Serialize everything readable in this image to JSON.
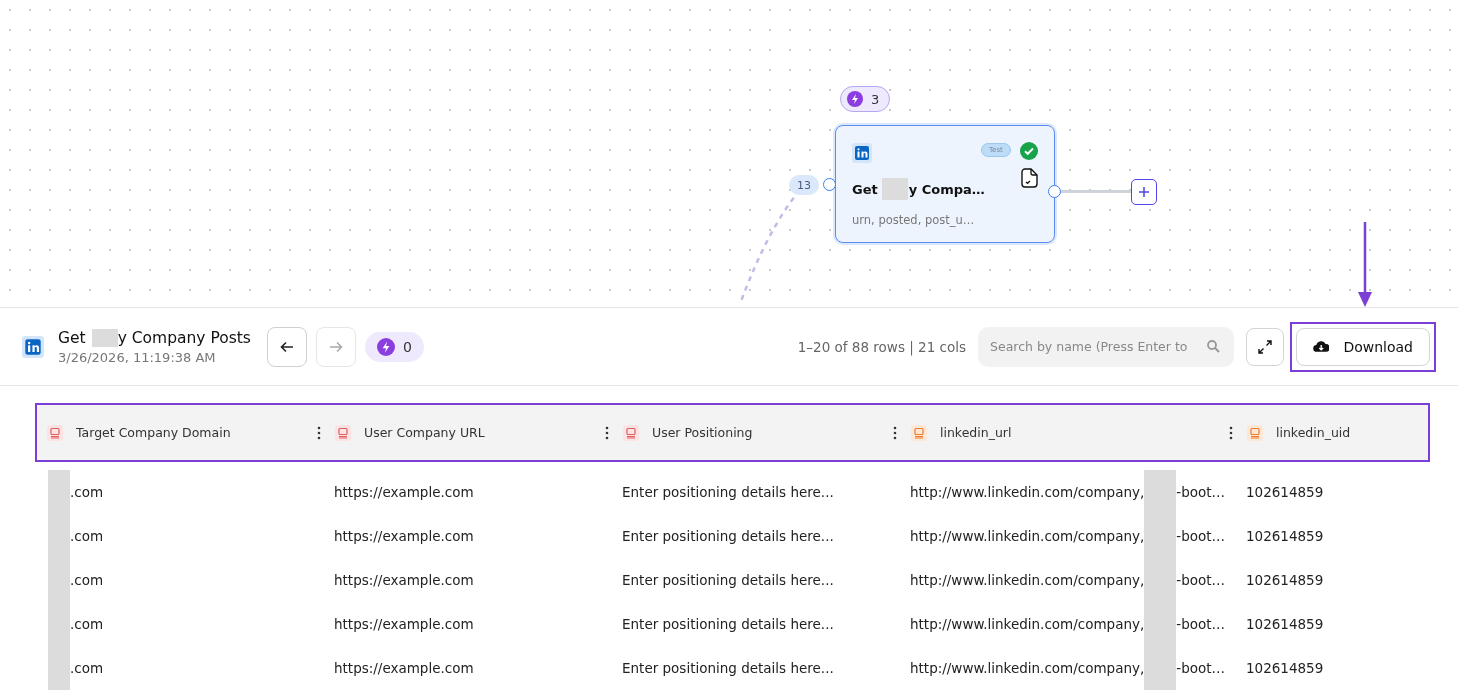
{
  "canvas": {
    "node": {
      "run_count": "3",
      "input_count": "13",
      "tag": "Test",
      "verified": true,
      "title_parts": [
        "Get",
        "y Compa…"
      ],
      "subtitle": "urn, posted, post_u…"
    }
  },
  "panel": {
    "title_parts": [
      "Get",
      "y Company Posts"
    ],
    "timestamp": "3/26/2026, 11:19:38 AM",
    "back_disabled": false,
    "forward_disabled": true,
    "credits": "0",
    "summary": "1–20 of 88 rows | 21 cols",
    "search": {
      "placeholder": "Search by name (Press Enter to"
    },
    "download": "Download"
  },
  "table": {
    "columns": [
      {
        "label": "Target Company Domain",
        "kind": "input",
        "menu": true
      },
      {
        "label": "User Company URL",
        "kind": "input",
        "menu": true
      },
      {
        "label": "User Positioning",
        "kind": "input",
        "menu": true
      },
      {
        "label": "linkedin_url",
        "kind": "output",
        "menu": true
      },
      {
        "label": "linkedin_uid",
        "kind": "output",
        "menu": false
      }
    ],
    "rows": [
      [
        {
          "parts": [
            ".com"
          ],
          "redacted": true
        },
        {
          "parts": [
            "https://example.com"
          ],
          "redacted": false
        },
        {
          "parts": [
            "Enter positioning details here..."
          ],
          "redacted": false
        },
        {
          "parts": [
            "http://www.linkedin.com/company,",
            "-boot…"
          ],
          "redacted": true
        },
        {
          "parts": [
            "102614859"
          ],
          "redacted": false
        }
      ],
      [
        {
          "parts": [
            ".com"
          ],
          "redacted": true
        },
        {
          "parts": [
            "https://example.com"
          ],
          "redacted": false
        },
        {
          "parts": [
            "Enter positioning details here..."
          ],
          "redacted": false
        },
        {
          "parts": [
            "http://www.linkedin.com/company,",
            "-boot…"
          ],
          "redacted": true
        },
        {
          "parts": [
            "102614859"
          ],
          "redacted": false
        }
      ],
      [
        {
          "parts": [
            ".com"
          ],
          "redacted": true
        },
        {
          "parts": [
            "https://example.com"
          ],
          "redacted": false
        },
        {
          "parts": [
            "Enter positioning details here..."
          ],
          "redacted": false
        },
        {
          "parts": [
            "http://www.linkedin.com/company,",
            "-boot…"
          ],
          "redacted": true
        },
        {
          "parts": [
            "102614859"
          ],
          "redacted": false
        }
      ],
      [
        {
          "parts": [
            ".com"
          ],
          "redacted": true
        },
        {
          "parts": [
            "https://example.com"
          ],
          "redacted": false
        },
        {
          "parts": [
            "Enter positioning details here..."
          ],
          "redacted": false
        },
        {
          "parts": [
            "http://www.linkedin.com/company,",
            "-boot…"
          ],
          "redacted": true
        },
        {
          "parts": [
            "102614859"
          ],
          "redacted": false
        }
      ],
      [
        {
          "parts": [
            ".com"
          ],
          "redacted": true
        },
        {
          "parts": [
            "https://example.com"
          ],
          "redacted": false
        },
        {
          "parts": [
            "Enter positioning details here..."
          ],
          "redacted": false
        },
        {
          "parts": [
            "http://www.linkedin.com/company,",
            "-boot…"
          ],
          "redacted": true
        },
        {
          "parts": [
            "102614859"
          ],
          "redacted": false
        }
      ]
    ]
  }
}
